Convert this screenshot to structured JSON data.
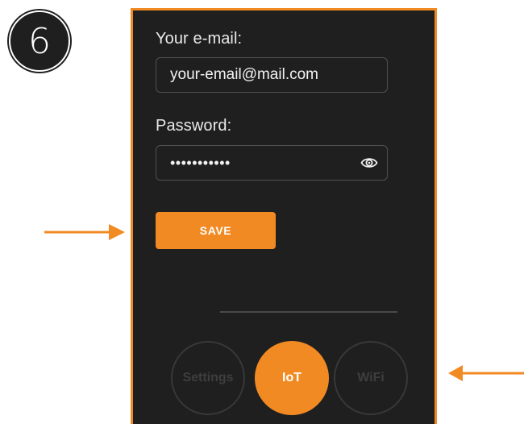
{
  "step": {
    "number": "6"
  },
  "form": {
    "email_label": "Your e-mail:",
    "email_value": "your-email@mail.com",
    "password_label": "Password:",
    "password_value": "•••••••••••",
    "password_toggle_icon": "eye-icon",
    "save_label": "SAVE"
  },
  "nav": {
    "items": [
      {
        "label": "Settings",
        "active": false
      },
      {
        "label": "IoT",
        "active": true
      },
      {
        "label": "WiFi",
        "active": false
      }
    ]
  },
  "colors": {
    "accent": "#f28a23",
    "screen_background": "#1f1f1f",
    "input_border": "#505050",
    "inactive_nav": "#383838"
  }
}
